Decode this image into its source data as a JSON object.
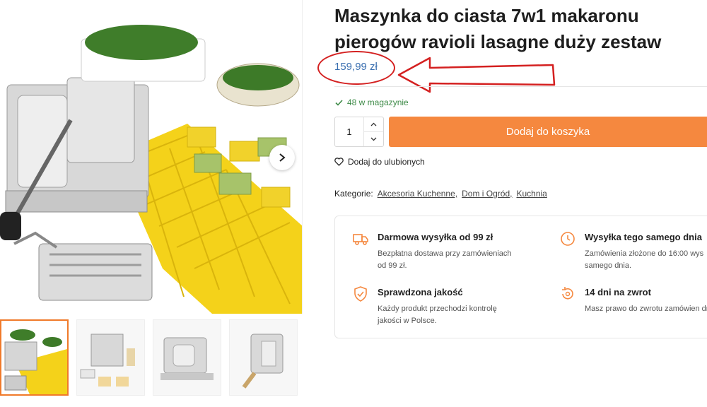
{
  "product": {
    "title": "Maszynka do ciasta 7w1 makaronu pierogów ravioli lasagne duży zestaw",
    "price": "159,99 zł",
    "stock": "48 w magazynie",
    "quantity": "1",
    "add_to_cart": "Dodaj do koszyka",
    "wishlist": "Dodaj do ulubionych"
  },
  "categories": {
    "label": "Kategorie:",
    "items": [
      "Akcesoria Kuchenne,",
      "Dom i Ogród,",
      "Kuchnia"
    ]
  },
  "features": [
    {
      "title": "Darmowa wysyłka od 99 zł",
      "desc": "Bezpłatna dostawa przy zamówieniach od 99 zł.",
      "icon": "truck-icon"
    },
    {
      "title": "Wysyłka tego samego dnia",
      "desc": "Zamówienia złożone do 16:00 wys samego dnia.",
      "icon": "clock-icon"
    },
    {
      "title": "Sprawdzona jakość",
      "desc": "Każdy produkt przechodzi kontrolę jakości w Polsce.",
      "icon": "shield-check-icon"
    },
    {
      "title": "14 dni na zwrot",
      "desc": "Masz prawo do zwrotu zamówien dni.",
      "icon": "return-icon"
    }
  ],
  "colors": {
    "accent": "#f5883f",
    "price": "#3a6fb0",
    "stock": "#3d8a47",
    "annotation": "#d42020"
  }
}
